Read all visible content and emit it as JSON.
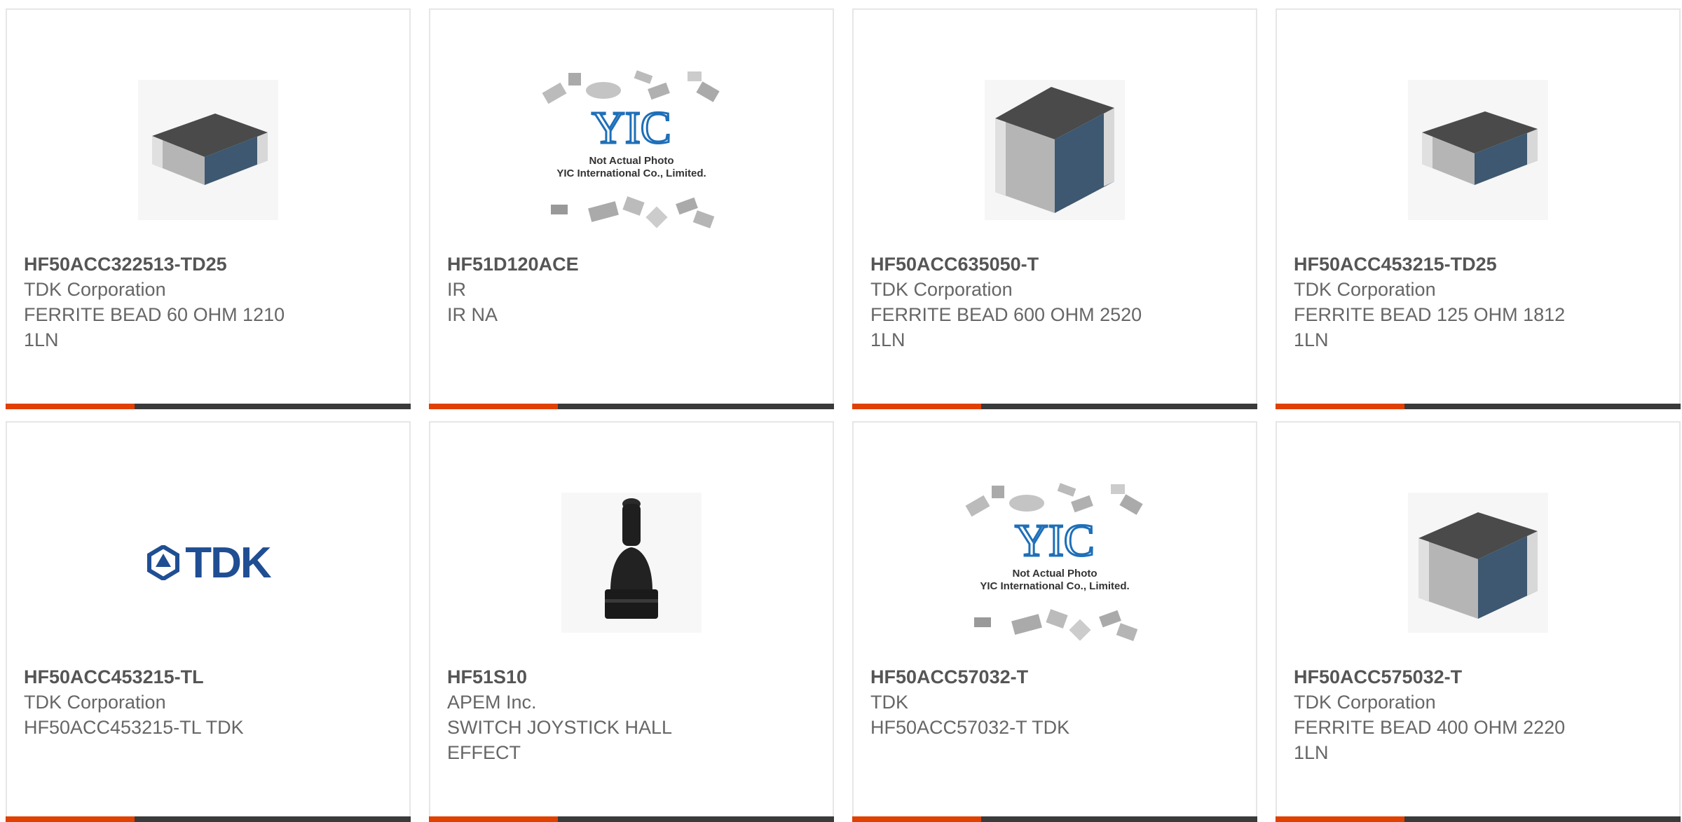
{
  "products": [
    {
      "part_number": "HF50ACC322513-TD25",
      "manufacturer": "TDK Corporation",
      "description": "FERRITE BEAD 60 OHM 1210\n1LN",
      "image": "chip-bead-photo"
    },
    {
      "part_number": "HF51D120ACE",
      "manufacturer": "IR",
      "description": "IR NA",
      "image": "yic-placeholder",
      "placeholder_brand": "YIC",
      "placeholder_line1": "Not Actual Photo",
      "placeholder_line2": "YIC International Co., Limited."
    },
    {
      "part_number": "HF50ACC635050-T",
      "manufacturer": "TDK Corporation",
      "description": "FERRITE BEAD 600 OHM 2520\n1LN",
      "image": "chip-bead-photo"
    },
    {
      "part_number": "HF50ACC453215-TD25",
      "manufacturer": "TDK Corporation",
      "description": "FERRITE BEAD 125 OHM 1812\n1LN",
      "image": "chip-bead-photo"
    },
    {
      "part_number": "HF50ACC453215-TL",
      "manufacturer": "TDK Corporation",
      "description": "HF50ACC453215-TL TDK",
      "image": "tdk-logo",
      "logo_text": "TDK"
    },
    {
      "part_number": "HF51S10",
      "manufacturer": "APEM Inc.",
      "description": "SWITCH JOYSTICK HALL\nEFFECT",
      "image": "joystick-photo"
    },
    {
      "part_number": "HF50ACC57032-T",
      "manufacturer": "TDK",
      "description": "HF50ACC57032-T TDK",
      "image": "yic-placeholder",
      "placeholder_brand": "YIC",
      "placeholder_line1": "Not Actual Photo",
      "placeholder_line2": "YIC International Co., Limited."
    },
    {
      "part_number": "HF50ACC575032-T",
      "manufacturer": "TDK Corporation",
      "description": "FERRITE BEAD 400 OHM 2220\n1LN",
      "image": "chip-bead-photo"
    }
  ],
  "colors": {
    "accent": "#e04000",
    "bar": "#3a3a3a",
    "tdk_blue": "#1f4e93",
    "yic_blue": "#1e6fb8"
  }
}
